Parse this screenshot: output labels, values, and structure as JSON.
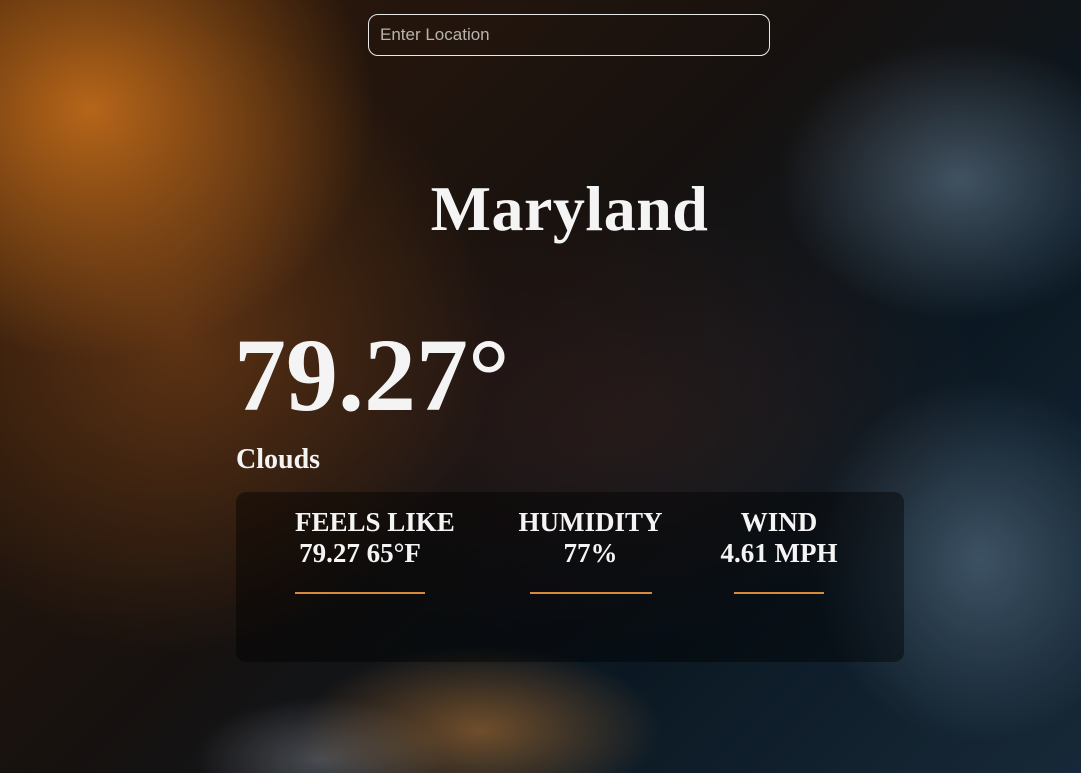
{
  "search": {
    "placeholder": "Enter Location",
    "value": ""
  },
  "location": {
    "name": "Maryland"
  },
  "current": {
    "temperature": "79.27°",
    "description": "Clouds"
  },
  "details": [
    {
      "label": "FEELS LIKE",
      "value": "79.27 65°F"
    },
    {
      "label": "HUMIDITY",
      "value": "77%"
    },
    {
      "label": "WIND",
      "value": "4.61 MPH"
    }
  ],
  "colors": {
    "accent": "#d78b3a",
    "text": "#f4f4f4"
  }
}
